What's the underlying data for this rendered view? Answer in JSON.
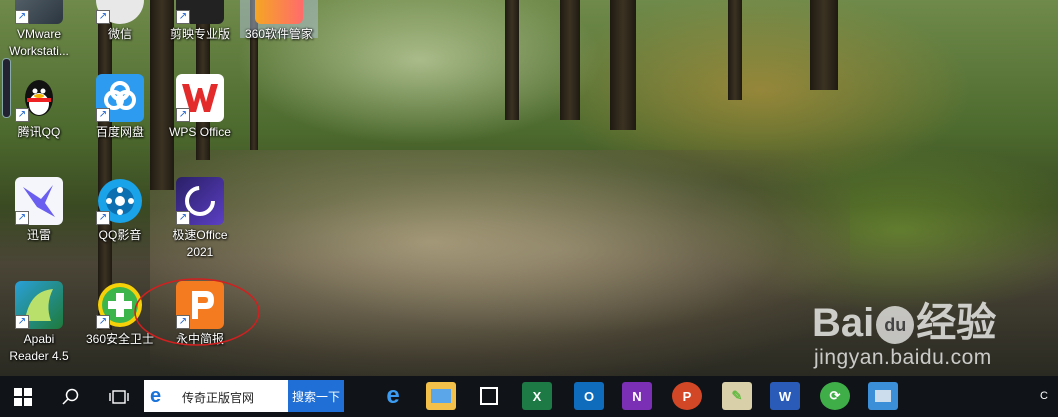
{
  "desktop": {
    "icons": [
      {
        "label1": "VMware",
        "label2": "Workstati...",
        "icon": "vmware-icon"
      },
      {
        "label1": "微信",
        "label2": "",
        "icon": "wechat-icon"
      },
      {
        "label1": "剪映专业版",
        "label2": "",
        "icon": "jianying-icon"
      },
      {
        "label1": "360软件管家",
        "label2": "",
        "icon": "360-software-manager-icon"
      },
      {
        "label1": "腾讯QQ",
        "label2": "",
        "icon": "qq-icon"
      },
      {
        "label1": "百度网盘",
        "label2": "",
        "icon": "baidu-netdisk-icon"
      },
      {
        "label1": "WPS Office",
        "label2": "",
        "icon": "wps-office-icon"
      },
      {
        "label1": "迅雷",
        "label2": "",
        "icon": "xunlei-icon"
      },
      {
        "label1": "QQ影音",
        "label2": "",
        "icon": "qq-player-icon"
      },
      {
        "label1": "极速Office",
        "label2": "2021",
        "icon": "jisu-office-icon"
      },
      {
        "label1": "Apabi",
        "label2": "Reader 4.5",
        "icon": "apabi-reader-icon"
      },
      {
        "label1": "360安全卫士",
        "label2": "",
        "icon": "360-security-icon"
      },
      {
        "label1": "永中简报",
        "label2": "",
        "icon": "yozo-presentation-icon"
      }
    ]
  },
  "taskbar": {
    "search_text": "传奇正版官网",
    "search_button": "搜索一下",
    "apps": [
      "edge",
      "file-explorer",
      "store",
      "excel",
      "outlook",
      "onenote",
      "powerpoint",
      "paint",
      "word",
      "green-app",
      "blue-app"
    ],
    "clock_partial": "C"
  },
  "watermark": {
    "brand": "Bai",
    "brand2": "du",
    "brand3": "经验",
    "url": "jingyan.baidu.com"
  }
}
